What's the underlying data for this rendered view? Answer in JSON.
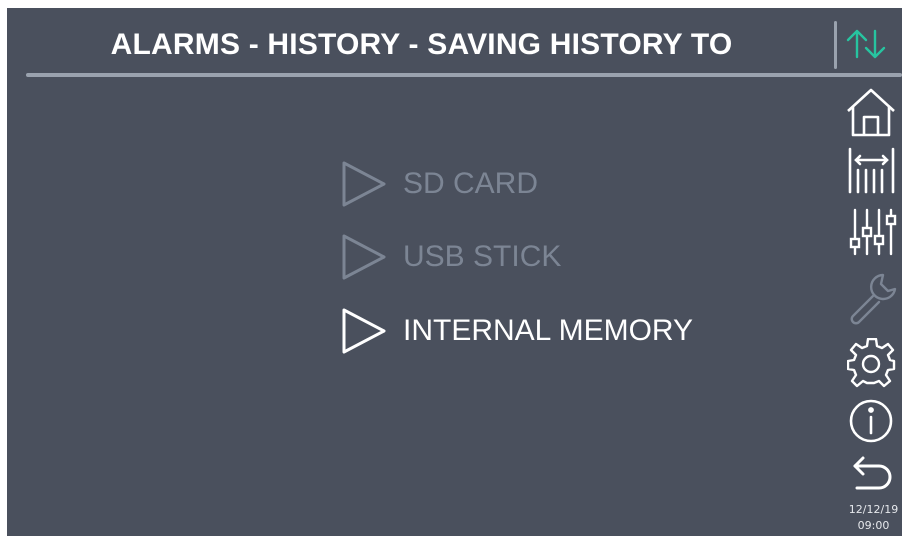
{
  "header": {
    "title": "ALARMS - HISTORY - SAVING HISTORY TO",
    "transfer_icon": "up-down-arrows-icon"
  },
  "menu": {
    "items": [
      {
        "label": "SD CARD",
        "state": "disabled"
      },
      {
        "label": "USB STICK",
        "state": "disabled"
      },
      {
        "label": "INTERNAL MEMORY",
        "state": "active"
      }
    ]
  },
  "sidebar": {
    "icons": [
      "home-icon",
      "measure-icon",
      "sliders-icon",
      "wrench-icon",
      "gear-icon",
      "info-icon",
      "back-icon"
    ]
  },
  "status": {
    "date": "12/12/19",
    "time": "09:00"
  },
  "colors": {
    "background": "#4a505d",
    "text_active": "#ffffff",
    "text_disabled": "#7c8594",
    "accent_arrows": "#27c4a0",
    "rule": "#9aa2ae"
  }
}
